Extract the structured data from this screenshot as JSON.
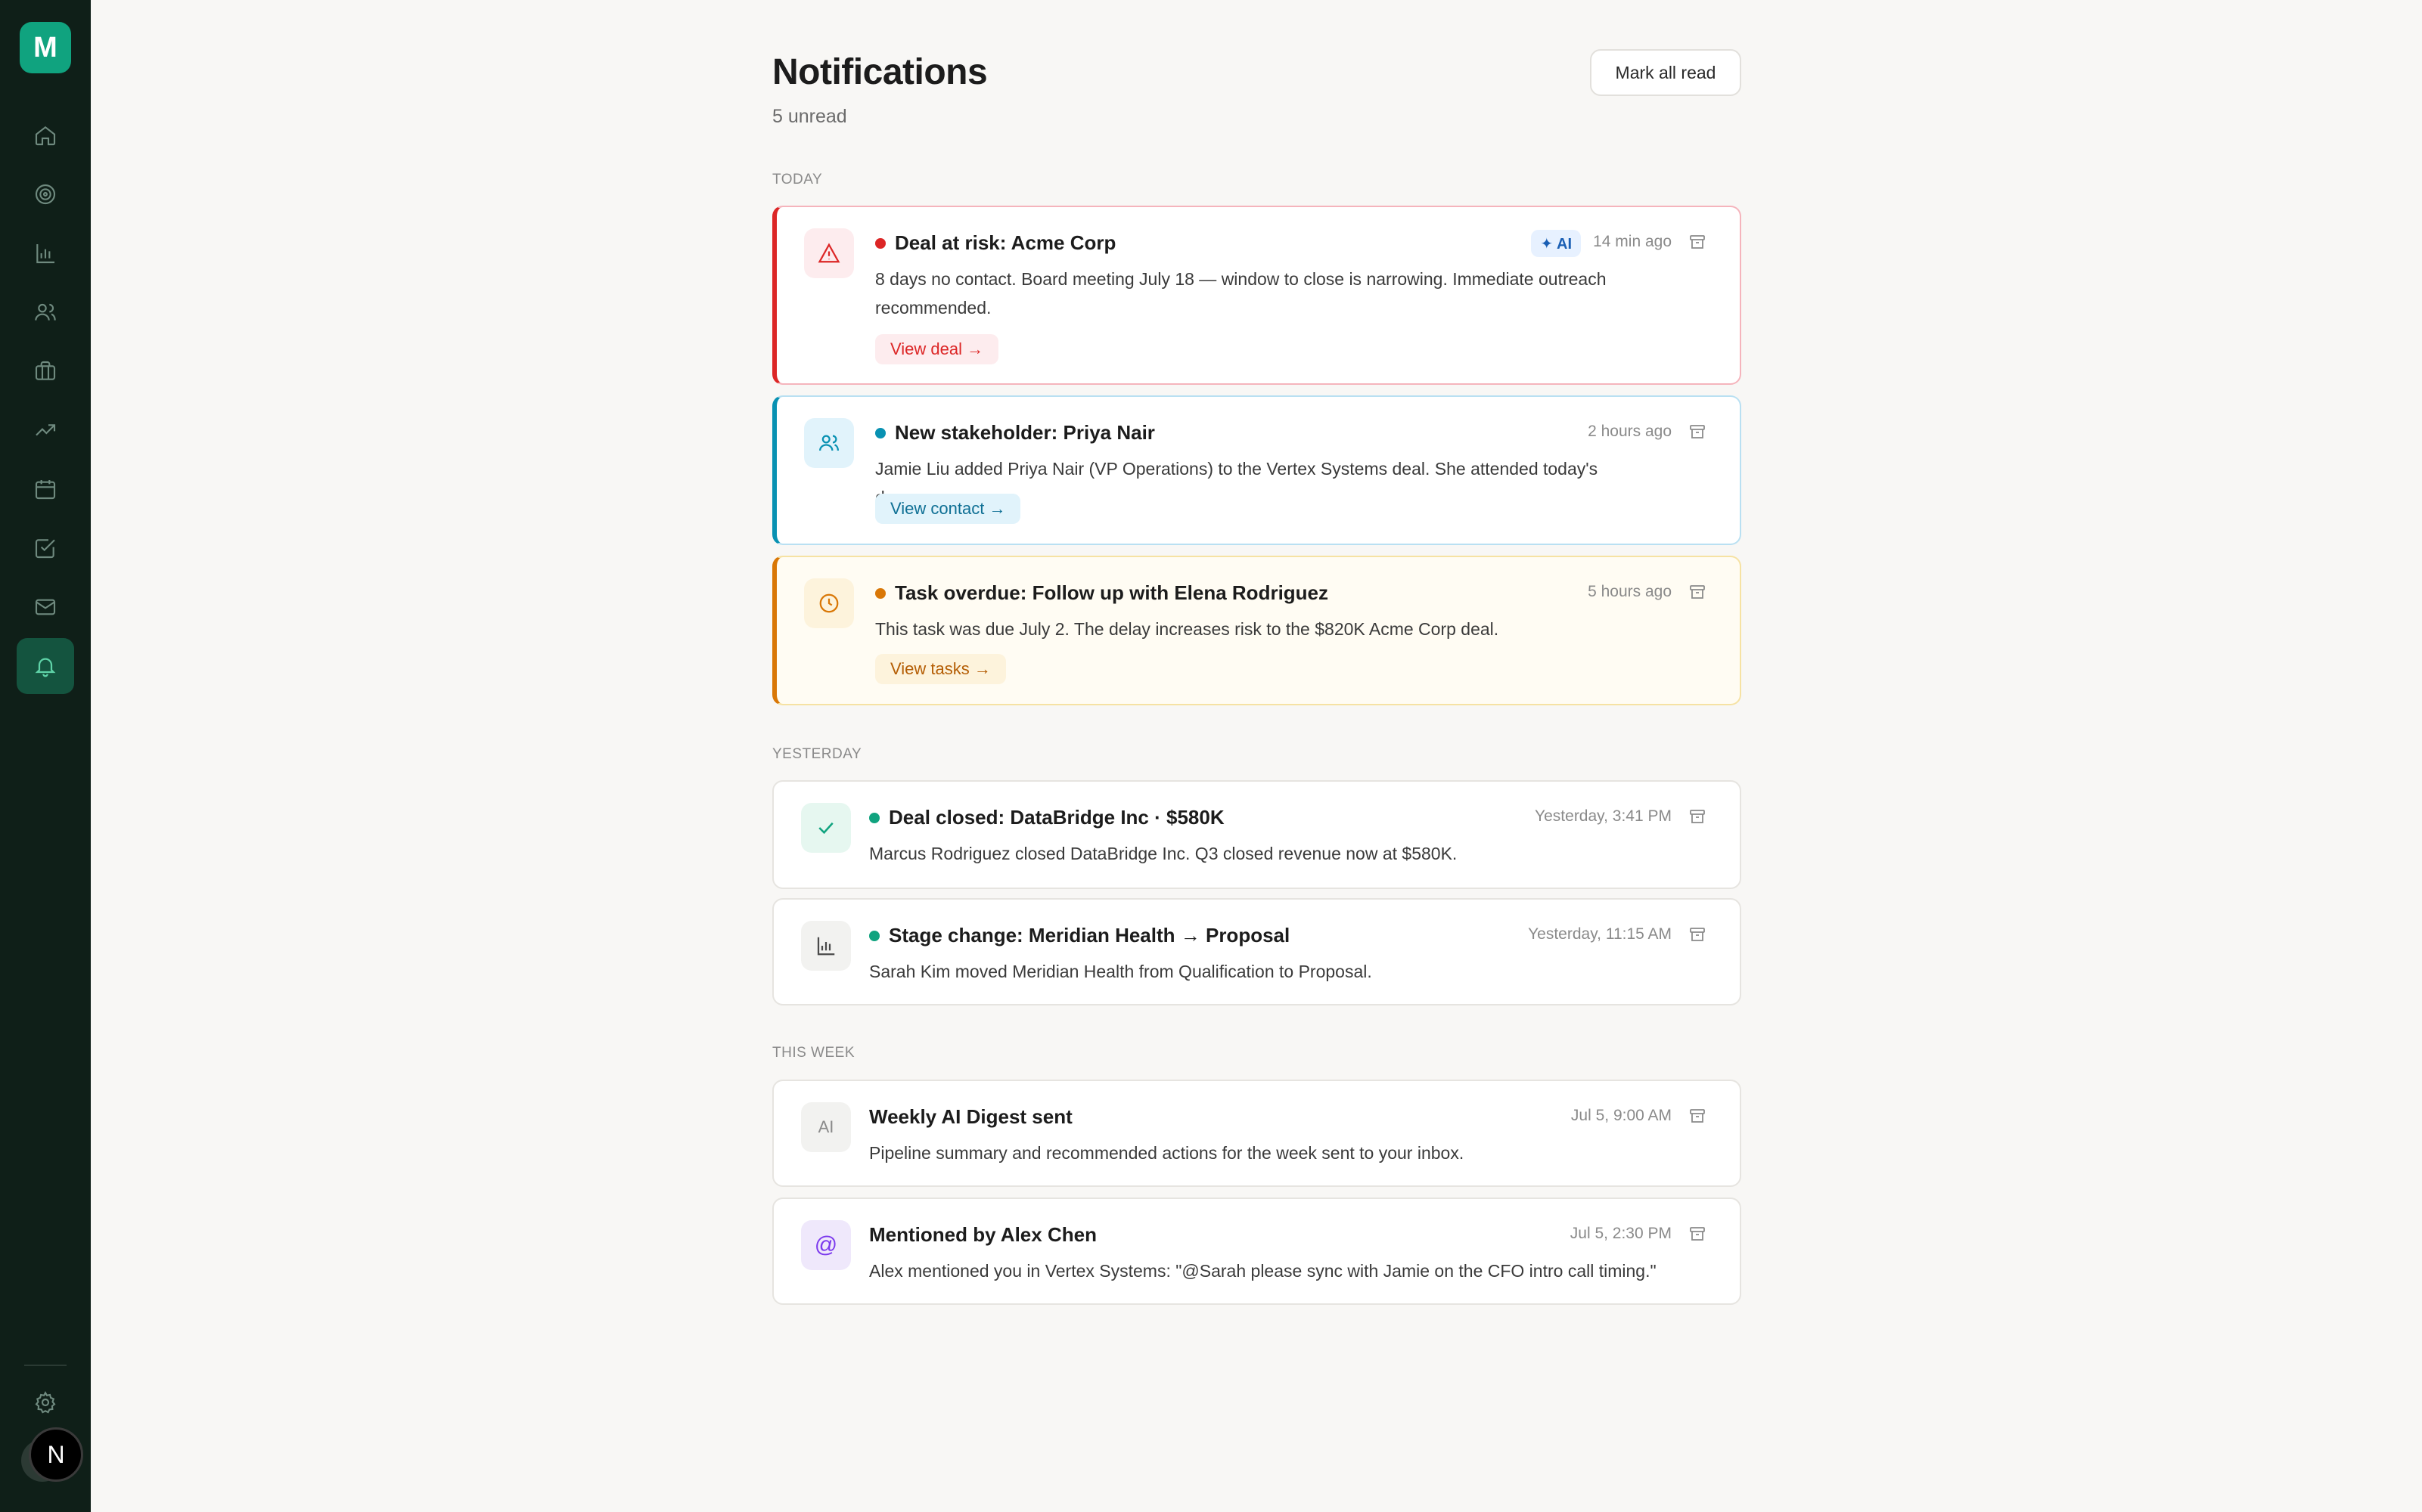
{
  "app": {
    "logo_letter": "M",
    "avatar_letter": "N",
    "nav": [
      {
        "name": "home-icon"
      },
      {
        "name": "target-icon"
      },
      {
        "name": "bar-chart-icon"
      },
      {
        "name": "users-icon"
      },
      {
        "name": "briefcase-icon"
      },
      {
        "name": "trending-up-icon"
      },
      {
        "name": "calendar-icon"
      },
      {
        "name": "checkbox-icon"
      },
      {
        "name": "mail-icon"
      },
      {
        "name": "bell-icon",
        "active": true
      }
    ],
    "settings_icon": "gear-icon"
  },
  "header": {
    "title": "Notifications",
    "subtitle": "5 unread",
    "mark_all_label": "Mark all read"
  },
  "sections": {
    "today": "TODAY",
    "yesterday": "YESTERDAY",
    "this_week": "THIS WEEK"
  },
  "notifications": [
    {
      "title": "Deal at risk: Acme Corp",
      "body": "8 days no contact. Board meeting July 18 — window to close is narrowing. Immediate outreach recommended.",
      "time": "14 min ago",
      "badge": "✦ AI",
      "action": "View deal →",
      "icon": "warning-triangle-icon",
      "accent": "#dc2626"
    },
    {
      "title": "New stakeholder: Priya Nair",
      "body": "Jamie Liu added Priya Nair (VP Operations) to the Vertex Systems deal. She attended today's demo.",
      "time": "2 hours ago",
      "action": "View contact →",
      "icon": "users-icon",
      "accent": "#0891b2"
    },
    {
      "title": "Task overdue: Follow up with Elena Rodriguez",
      "body": "This task was due July 2. The delay increases risk to the $820K Acme Corp deal.",
      "time": "5 hours ago",
      "action": "View tasks →",
      "icon": "clock-icon",
      "accent": "#d97706"
    },
    {
      "title": "Deal closed: DataBridge Inc · $580K",
      "body": "Marcus Rodriguez closed DataBridge Inc. Q3 closed revenue now at $580K.",
      "time": "Yesterday, 3:41 PM",
      "icon": "check-icon",
      "accent": "#10a37f"
    },
    {
      "title": "Stage change: Meridian Health → Proposal",
      "body": "Sarah Kim moved Meridian Health from Qualification to Proposal.",
      "time": "Yesterday, 11:15 AM",
      "icon": "bar-chart-icon",
      "accent": "#10a37f"
    },
    {
      "title": "Weekly AI Digest sent",
      "body": "Pipeline summary and recommended actions for the week sent to your inbox.",
      "time": "Jul 5, 9:00 AM",
      "icon_text": "AI",
      "icon": "ai-icon"
    },
    {
      "title": "Mentioned by Alex Chen",
      "body": "Alex mentioned you in Vertex Systems: \"@Sarah please sync with Jamie on the CFO intro call timing.\"",
      "time": "Jul 5, 2:30 PM",
      "icon_text": "@",
      "icon": "at-icon"
    }
  ]
}
